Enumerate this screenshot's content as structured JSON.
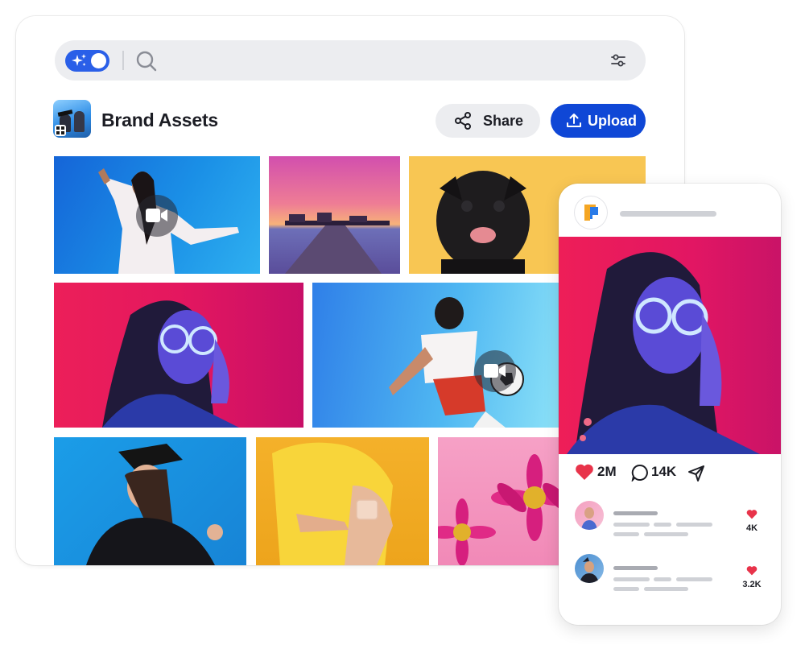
{
  "search": {
    "toggle_icon": "sparkle-icon",
    "search_icon": "search-icon",
    "filter_icon": "sliders-icon"
  },
  "header": {
    "title": "Brand Assets",
    "share_label": "Share",
    "upload_label": "Upload"
  },
  "colors": {
    "accent": "#0f47d6",
    "toggle": "#2a5fe8",
    "surface": "#ecedf0",
    "like": "#e8334a"
  },
  "gallery": {
    "tiles": [
      {
        "subject": "woman dancing",
        "video": true
      },
      {
        "subject": "sunset pier"
      },
      {
        "subject": "pug dog"
      },
      {
        "subject": "woman with glasses"
      },
      {
        "subject": "soccer player",
        "video": true
      },
      {
        "subject": "graduate"
      },
      {
        "subject": "child with bandage"
      },
      {
        "subject": "pink flowers"
      }
    ]
  },
  "phone": {
    "likes": "2M",
    "comments": "14K",
    "comment_items": [
      {
        "count": "4K"
      },
      {
        "count": "3.2K"
      }
    ]
  }
}
